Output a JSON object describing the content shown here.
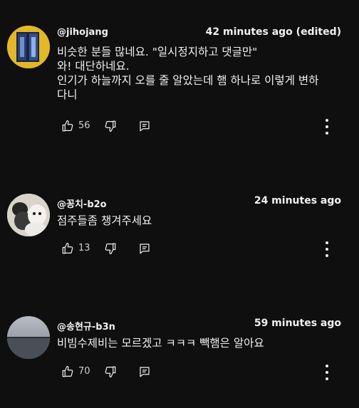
{
  "comments": [
    {
      "handle": "@jihojang",
      "time": "42 minutes ago (edited)",
      "lines": [
        "비슷한 분들 많네요. \"일시정지하고 댓글만\"",
        "와! 대단하네요.",
        "인기가 하늘까지 오를 줄 알았는데 햄 하나로 이렇게 변하",
        "다니"
      ],
      "likes": "56"
    },
    {
      "handle": "@꽁치-b2o",
      "time": "24 minutes ago",
      "lines": [
        "점주들좀 챙겨주세요"
      ],
      "likes": "13"
    },
    {
      "handle": "@송현규-b3n",
      "time": "59 minutes ago",
      "lines": [
        "비빔수제비는 모르겠고 ㅋㅋㅋ 빽햄은 알아요"
      ],
      "likes": "70"
    }
  ],
  "icons": [
    "thumbs-up-icon",
    "thumbs-down-icon",
    "reply-icon",
    "more-vert-icon"
  ]
}
